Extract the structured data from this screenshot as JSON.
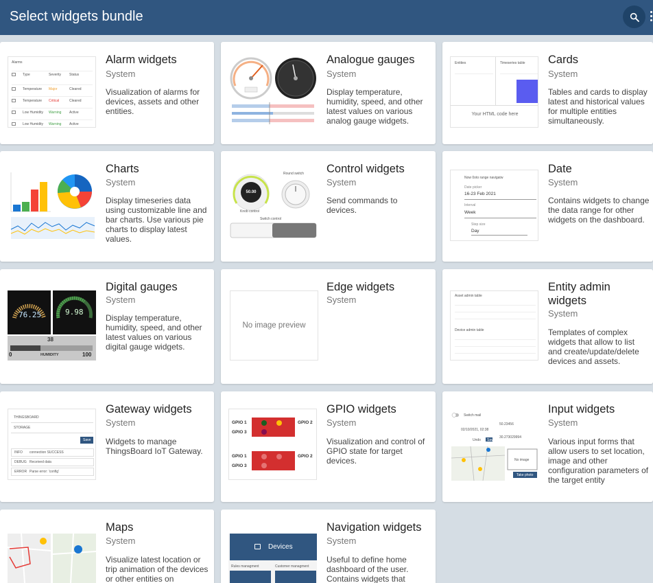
{
  "header": {
    "title": "Select widgets bundle",
    "search_icon": "search-icon",
    "more_icon": "more-vert-icon"
  },
  "bundles": [
    {
      "name": "Alarm widgets",
      "system": "System",
      "desc": "Visualization of alarms for devices, assets and other entities."
    },
    {
      "name": "Analogue gauges",
      "system": "System",
      "desc": "Display temperature, humidity, speed, and other latest values on various analog gauge widgets."
    },
    {
      "name": "Cards",
      "system": "System",
      "desc": "Tables and cards to display latest and historical values for multiple entities simultaneously."
    },
    {
      "name": "Charts",
      "system": "System",
      "desc": "Display timeseries data using customizable line and bar charts. Use various pie charts to display latest values."
    },
    {
      "name": "Control widgets",
      "system": "System",
      "desc": "Send commands to devices."
    },
    {
      "name": "Date",
      "system": "System",
      "desc": "Contains widgets to change the data range for other widgets on the dashboard."
    },
    {
      "name": "Digital gauges",
      "system": "System",
      "desc": "Display temperature, humidity, speed, and other latest values on various digital gauge widgets."
    },
    {
      "name": "Edge widgets",
      "system": "System",
      "desc": ""
    },
    {
      "name": "Entity admin widgets",
      "system": "System",
      "desc": "Templates of complex widgets that allow to list and create/update/delete devices and assets."
    },
    {
      "name": "Gateway widgets",
      "system": "System",
      "desc": "Widgets to manage ThingsBoard IoT Gateway."
    },
    {
      "name": "GPIO widgets",
      "system": "System",
      "desc": "Visualization and control of GPIO state for target devices."
    },
    {
      "name": "Input widgets",
      "system": "System",
      "desc": "Various input forms that allow users to set location, image and other configuration parameters of the target entity"
    },
    {
      "name": "Maps",
      "system": "System",
      "desc": "Visualize latest location or trip animation of the devices or other entities on"
    },
    {
      "name": "Navigation widgets",
      "system": "System",
      "desc": "Useful to define home dashboard of the user. Contains widgets that"
    }
  ],
  "previews": {
    "no_image": "No image preview",
    "alarm": {
      "title": "Alarms",
      "cols": [
        "Type",
        "Severity",
        "Status"
      ],
      "rows": [
        [
          "Temperature",
          "Major",
          "Cleared"
        ],
        [
          "Temperature",
          "Critical",
          "Cleared"
        ],
        [
          "Low Humidity",
          "Warning",
          "Active"
        ],
        [
          "Low Humidity",
          "Warning",
          "Active"
        ]
      ]
    },
    "cards": {
      "entities": "Entities",
      "timeseries": "Timeseries table",
      "html": "Your HTML code here"
    },
    "control": {
      "round_switch": "Round switch",
      "knob": "Knob control",
      "switch": "Switch control",
      "knob_value": "50.00"
    },
    "date": {
      "title": "Now 0oto range navigatw",
      "picker_label": "Date picker",
      "picker_value": "16-23 Feb 2021",
      "interval_label": "Interval",
      "interval_value": "Week",
      "step_label": "Step size",
      "step_value": "Day"
    },
    "digital": {
      "val1": "76.25",
      "val2": "9.98",
      "val3": "38",
      "humidity": "HUMIDITY",
      "min": "0",
      "max": "100"
    },
    "entity_admin": {
      "asset_table": "Asset admin table",
      "device_table": "Device admin table"
    },
    "gateway": {
      "row1": "THINGSBOARD",
      "row2": "STORAGE",
      "save": "Save",
      "logs": [
        [
          "INFO",
          "connection SUCCESS"
        ],
        [
          "DEBUG",
          "Received data"
        ],
        [
          "ERROR",
          "Parse error: 'config'"
        ]
      ]
    },
    "gpio": {
      "g1": "GPIO 1",
      "g2": "GPIO 2",
      "g3": "GPIO 3"
    },
    "input": {
      "switch_mail": "Switch mail",
      "undo": "Undo",
      "save": "Save",
      "latitude": "50.23456",
      "longitude": "30.273029994",
      "no_image": "No image",
      "take_photo": "Take photo",
      "date": "02/10/2021, 02:38"
    },
    "navigation": {
      "devices": "Devices",
      "rules": "Rules managment",
      "customers": "Customer managment"
    }
  },
  "colors": {
    "header": "#305680",
    "accent": "#305680",
    "background": "#d5dde4"
  }
}
